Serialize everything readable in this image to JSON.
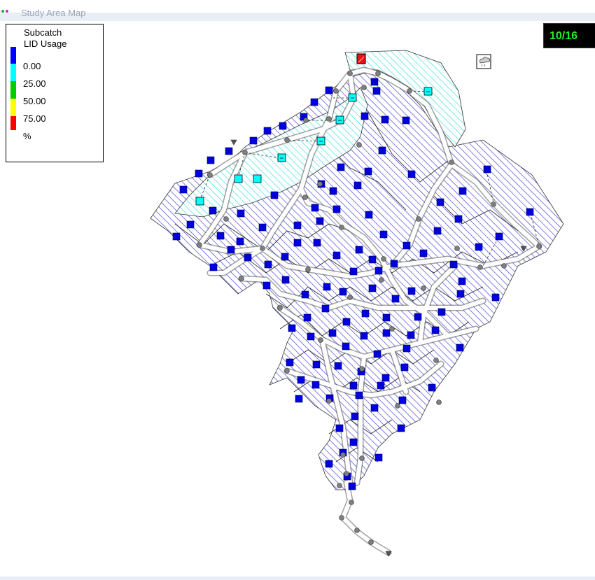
{
  "window": {
    "title": "Study Area Map",
    "date_display": "10/16"
  },
  "legend": {
    "title_line1": "Subcatch",
    "title_line2": "LID Usage",
    "levels": [
      {
        "label": "0.00",
        "color": "#0000ff"
      },
      {
        "label": "25.00",
        "color": "#00ffff"
      },
      {
        "label": "50.00",
        "color": "#00cc00"
      },
      {
        "label": "75.00",
        "color": "#ffff00"
      },
      {
        "label": "%",
        "color": "#ff0000"
      }
    ]
  },
  "colors": {
    "low_fill": "#3b3bcf",
    "cyan_fill": "#33dddd",
    "red_marker": "#ee1111",
    "node": "#7f7f7f",
    "conduit": "#ffffff"
  },
  "icons": {
    "rain_gage": "rain-gage-icon",
    "outfall": "outfall-triangle-icon"
  }
}
